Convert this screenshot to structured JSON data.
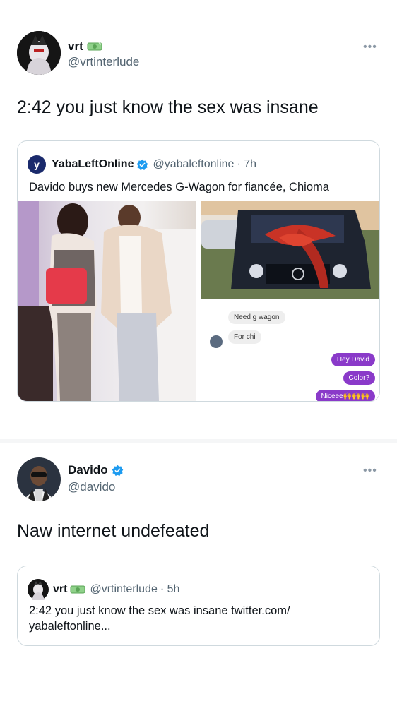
{
  "tweet1": {
    "name": "vrt",
    "handle": "@vrtinterlude",
    "text": "2:42  you just know the sex was insane",
    "quote": {
      "name": "YabaLeftOnline",
      "handle": "@yabaleftonline",
      "time": "· 7h",
      "text": "Davido buys new Mercedes G-Wagon for fiancée, Chioma",
      "chat": {
        "in_messages": [
          "Need g wagon",
          "For chi"
        ],
        "out_messages": [
          "Hey David",
          "Color?",
          "Niceee🙌🙌🙌"
        ]
      }
    }
  },
  "tweet2": {
    "name": "Davido",
    "handle": "@davido",
    "text": "Naw internet undefeated",
    "quote": {
      "name": "vrt",
      "handle": "@vrtinterlude",
      "time": "· 5h",
      "text_line1": "2:42  you just know the sex was insane twitter.com/",
      "text_line2": "yabaleftonline..."
    }
  },
  "colors": {
    "verified": "#1d9bf0",
    "handle_gray": "#536471",
    "border": "#cfd9de",
    "chat_purple": "#8a3ac9"
  },
  "icons": {
    "more": "more-dots-icon",
    "verified": "verified-badge-icon",
    "money": "money-emoji-icon"
  }
}
